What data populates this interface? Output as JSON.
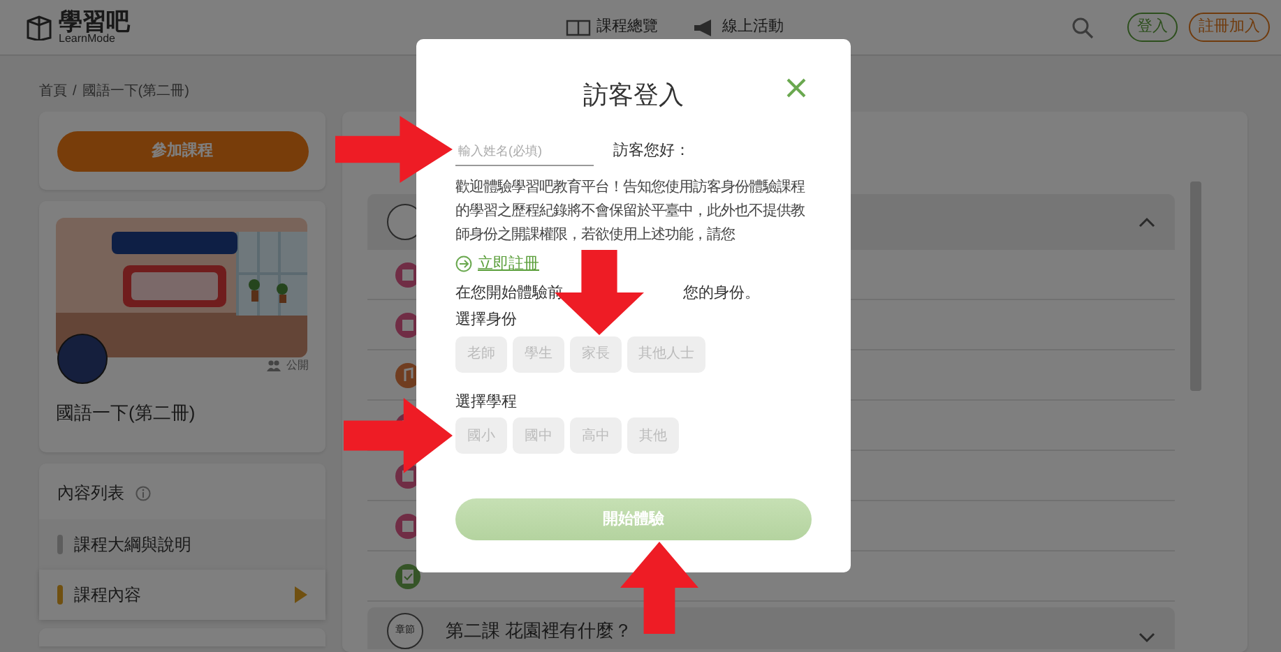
{
  "header": {
    "logo": "學習吧",
    "logo_sub": "LearnMode",
    "nav": [
      {
        "kind": "book",
        "label": "課程總覽"
      },
      {
        "kind": "megaphone",
        "label": "線上活動"
      }
    ],
    "login": "登入",
    "signup": "註冊加入"
  },
  "breadcrumb": {
    "items": [
      "首頁",
      "國語一下(第二冊)"
    ],
    "separator": "/"
  },
  "sidebar": {
    "join_button": "參加課程",
    "course": {
      "badge": "公開",
      "title": "國語一下(第二冊)"
    },
    "contents_title": "內容列表",
    "items": [
      {
        "label": "課程大綱與說明",
        "selected": false
      },
      {
        "label": "課程內容",
        "selected": true
      }
    ],
    "next_card": {
      "kind": "panel"
    }
  },
  "chapters": [
    {
      "expanded": true,
      "lessons": [
        {
          "kind": "book"
        },
        {
          "kind": "book"
        },
        {
          "kind": "music"
        },
        {
          "kind": "book"
        },
        {
          "kind": "book"
        },
        {
          "kind": "book"
        },
        {
          "kind": "quiz"
        }
      ]
    },
    {
      "badge": "章節",
      "title": "第二課 花園裡有什麼？",
      "expanded": false
    }
  ],
  "modal": {
    "title": "訪客登入",
    "name_field": {
      "placeholder": "輸入姓名(必填)"
    },
    "greeting": "訪客您好：",
    "notice": "歡迎體驗學習吧教育平台！告知您使用訪客身份體驗課程的學習之歷程紀錄將不會保留於平臺中，此外也不提供教師身份之開課權限，若欲使用上述功能，請您",
    "register_link": "立即註冊",
    "prompt_start": "在您開始體驗前",
    "prompt_end": "您的身份。",
    "groups": [
      {
        "label": "選擇身份",
        "options": [
          {
            "label": "老師",
            "selected": false
          },
          {
            "label": "學生",
            "selected": false
          },
          {
            "label": "家長",
            "selected": false
          },
          {
            "label": "其他人士",
            "selected": false
          }
        ]
      },
      {
        "label": "選擇學程",
        "options": [
          {
            "label": "國小",
            "selected": false
          },
          {
            "label": "國中",
            "selected": false
          },
          {
            "label": "高中",
            "selected": false
          },
          {
            "label": "其他",
            "selected": false
          }
        ]
      }
    ],
    "submit": {
      "label": "開始體驗",
      "disabled": true
    }
  },
  "annotations": [
    {
      "kind": "right"
    },
    {
      "kind": "down"
    },
    {
      "kind": "right"
    },
    {
      "kind": "up"
    }
  ]
}
